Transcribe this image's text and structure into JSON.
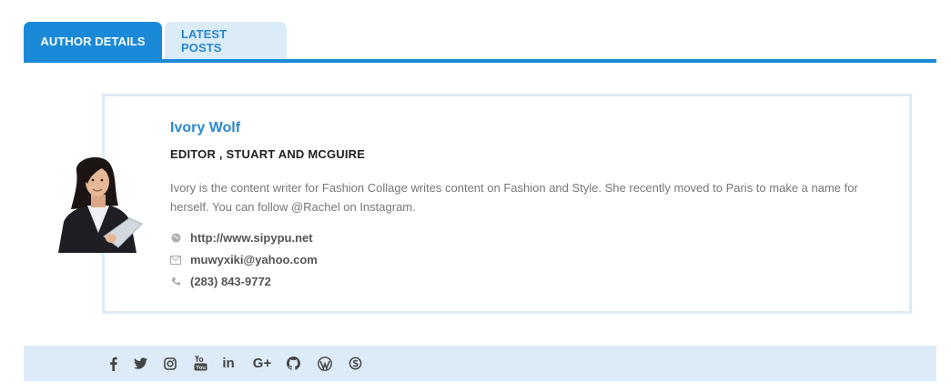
{
  "tabs": [
    {
      "label": "AUTHOR DETAILS",
      "active": true
    },
    {
      "label": "LATEST POSTS",
      "active": false
    }
  ],
  "author": {
    "name": "Ivory Wolf",
    "role": "EDITOR ,  STUART AND MCGUIRE",
    "bio": "Ivory is the content writer for Fashion Collage writes content on Fashion and Style. She recently moved to Paris to make a name for herself. You can follow @Rachel on Instagram.",
    "contacts": [
      {
        "icon": "globe-icon",
        "value": "http://www.sipypu.net"
      },
      {
        "icon": "envelope-icon",
        "value": "muwyxiki@yahoo.com"
      },
      {
        "icon": "phone-icon",
        "value": "(283) 843-9772"
      }
    ]
  },
  "social_links": [
    "facebook-icon",
    "twitter-icon",
    "instagram-icon",
    "youtube-icon",
    "linkedin-icon",
    "google-plus-icon",
    "github-icon",
    "wordpress-icon",
    "skype-icon"
  ],
  "social_text": {
    "linkedin": "in",
    "google_plus": "G+"
  },
  "colors": {
    "accent": "#1a8ad8",
    "tab_inactive_bg": "#dbebf7",
    "card_border": "#dcebf7",
    "name_color": "#2b88d1",
    "social_bar_bg": "#dcebf7"
  }
}
